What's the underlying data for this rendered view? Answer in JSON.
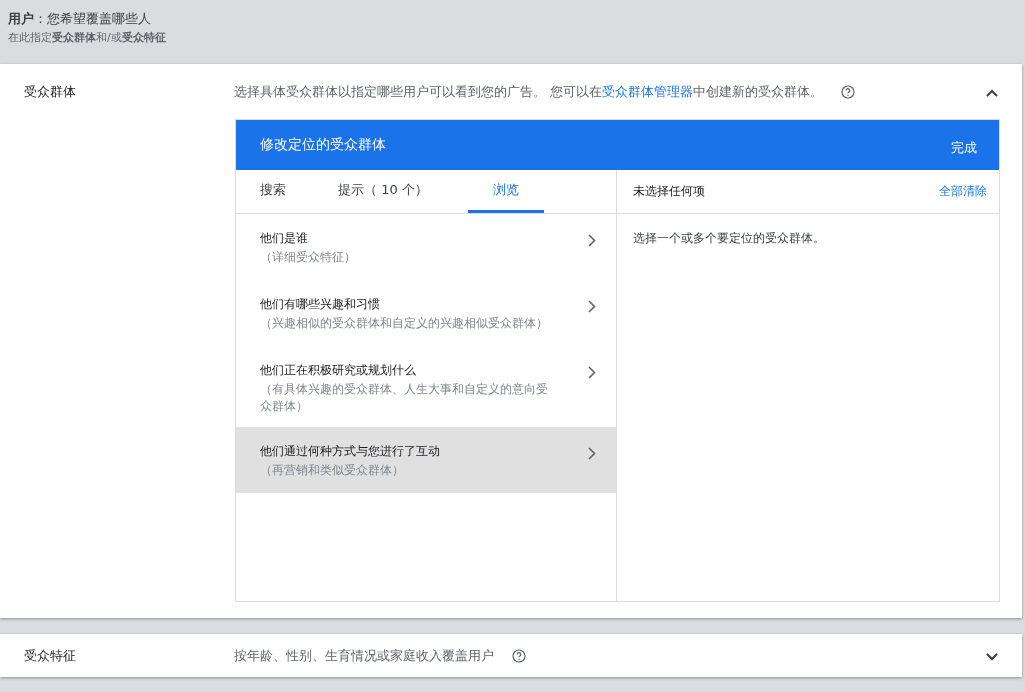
{
  "header": {
    "title": "**用户**：您希望覆盖哪些人",
    "subtitle": "在此指定**受众群体**和/或**受众特征**"
  },
  "sections": [
    {
      "label": "受众群体",
      "expanded": true,
      "description": {
        "before": "选择具体受众群体以指定哪些用户可以看到您的广告。 您可以在",
        "link": "受众群体管理器",
        "after": "中创建新的受众群体。"
      },
      "editor": {
        "title": "修改定位的受众群体",
        "done": "完成",
        "tabs": [
          {
            "label": "搜索",
            "selected": false
          },
          {
            "label": "提示（ 10 个）",
            "selected": false
          },
          {
            "label": "浏览",
            "selected": true
          }
        ],
        "items": [
          {
            "title": "他们是谁",
            "subtitle": "（详细受众特征）",
            "selected": false
          },
          {
            "title": "他们有哪些兴趣和习惯",
            "subtitle": "（兴趣相似的受众群体和自定义的兴趣相似受众群体）",
            "selected": false
          },
          {
            "title": "他们正在积极研究或规划什么",
            "subtitle": "（有具体兴趣的受众群体、人生大事和自定义的意向受众群体）",
            "selected": false
          },
          {
            "title": "他们通过何种方式与您进行了互动",
            "subtitle": "（再营销和类似受众群体）",
            "selected": true
          }
        ],
        "selection_title": "未选择任何项",
        "clear": "全部清除",
        "empty_message": "选择一个或多个要定位的受众群体。"
      }
    },
    {
      "label": "受众特征",
      "expanded": false,
      "description": {
        "before": "按年龄、性别、生育情况或家庭收入覆盖用户"
      }
    }
  ]
}
